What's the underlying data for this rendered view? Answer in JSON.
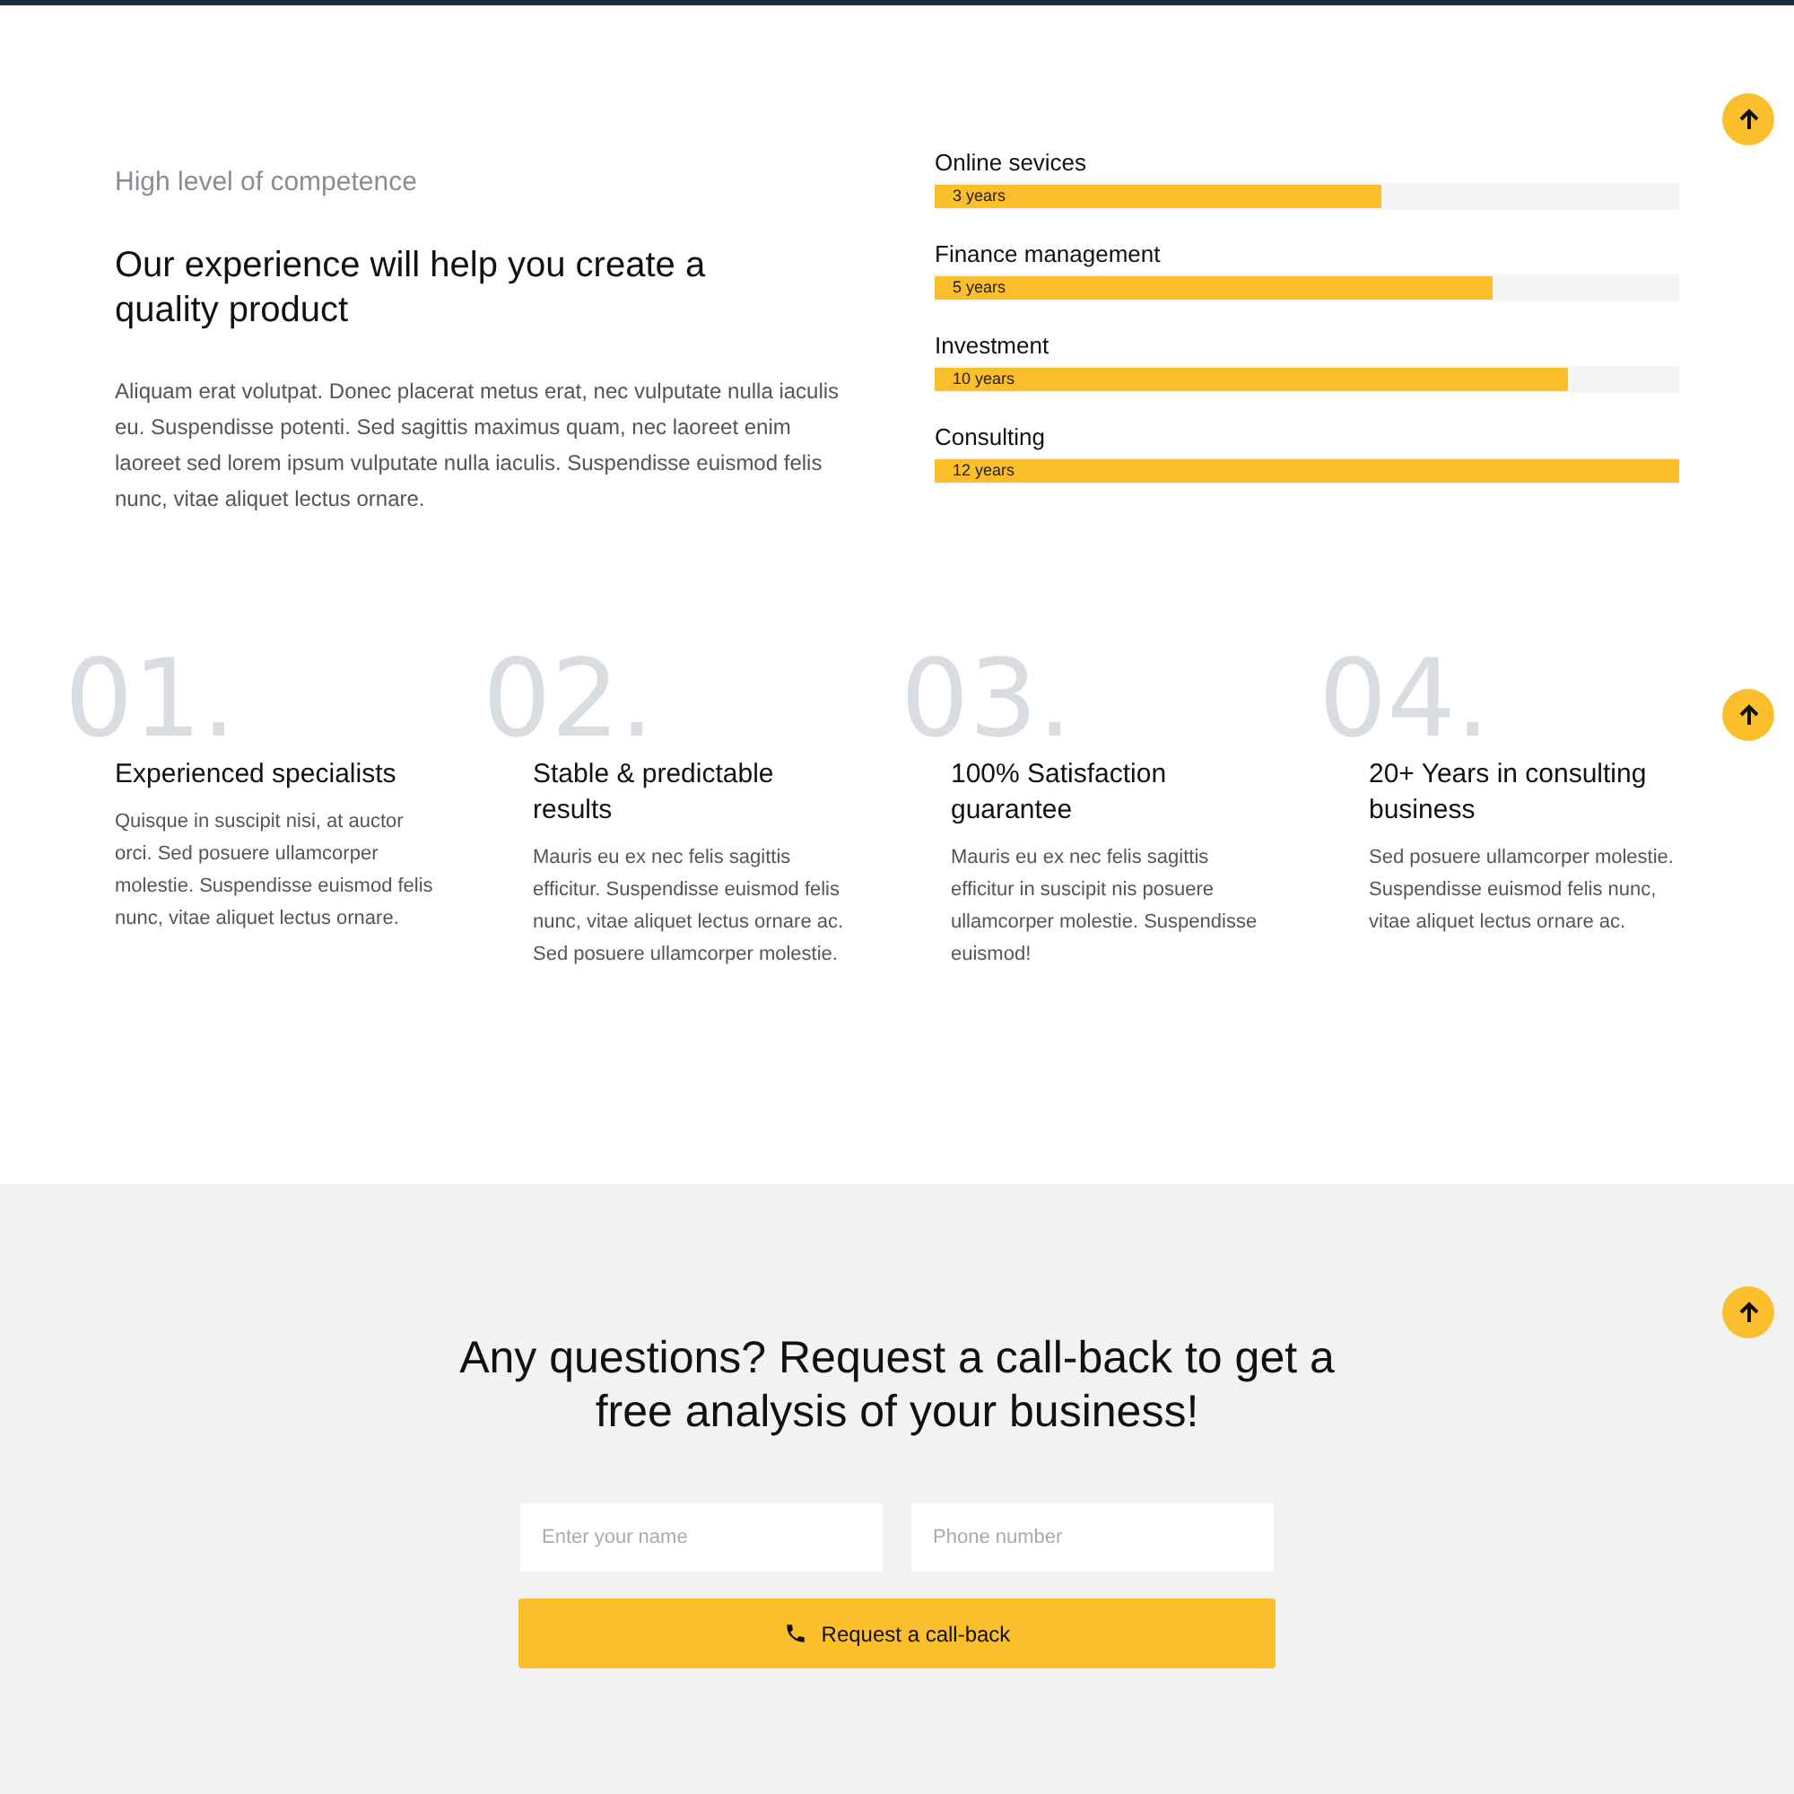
{
  "intro": {
    "eyebrow": "High level of competence",
    "heading": "Our experience will help you create a quality product",
    "body": "Aliquam erat volutpat. Donec placerat metus erat, nec vulputate nulla iaculis eu. Suspendisse potenti. Sed sagittis maximus quam, nec laoreet enim laoreet sed lorem ipsum vulputate nulla iaculis. Suspendisse euismod felis nunc, vitae aliquet lectus ornare."
  },
  "skills": [
    {
      "name": "Online sevices",
      "reading": "3 years",
      "level": 0.6
    },
    {
      "name": "Finance management",
      "reading": "5 years",
      "level": 0.75
    },
    {
      "name": "Investment",
      "reading": "10 years",
      "level": 0.85
    },
    {
      "name": "Consulting",
      "reading": "12 years",
      "level": 1
    }
  ],
  "features": [
    {
      "number": "01.",
      "title": "Experienced specialists",
      "text": "Quisque in suscipit nisi, at auctor orci. Sed posuere ullamcorper molestie. Suspendisse euismod felis nunc, vitae aliquet lectus ornare."
    },
    {
      "number": "02.",
      "title": "Stable & predictable results",
      "text": "Mauris eu ex nec felis sagittis efficitur. Suspendisse euismod felis nunc, vitae aliquet lectus ornare ac. Sed posuere ullamcorper molestie."
    },
    {
      "number": "03.",
      "title": "100% Satisfaction guarantee",
      "text": "Mauris eu ex nec felis sagittis efficitur in suscipit nis posuere ullamcorper molestie. Suspendisse euismod!"
    },
    {
      "number": "04.",
      "title": "20+ Years in consulting business",
      "text": "Sed posuere ullamcorper molestie. Suspendisse euismod felis nunc, vitae aliquet lectus ornare ac."
    }
  ],
  "callback": {
    "heading": "Any questions? Request a call-back to get a free analysis of your business!",
    "fields": [
      {
        "placeholder": "Enter your name"
      },
      {
        "placeholder": "Phone number"
      }
    ],
    "button": "Request a call-back"
  }
}
